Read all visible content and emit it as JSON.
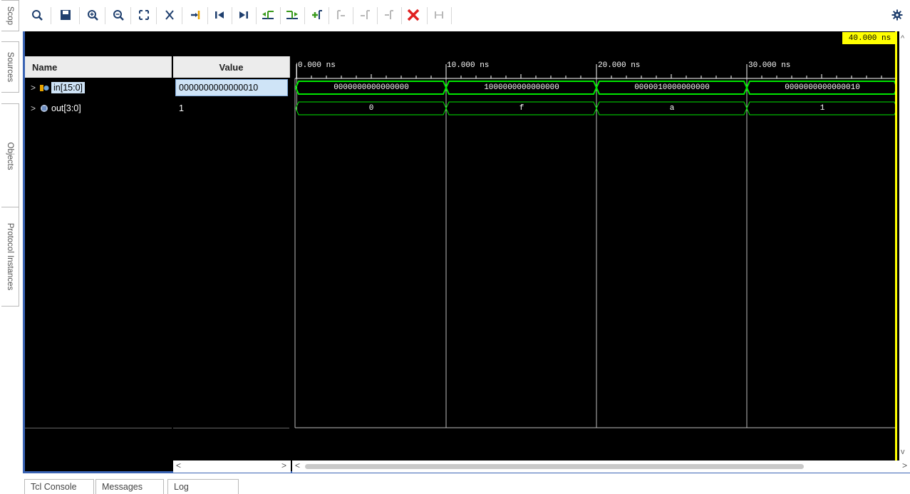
{
  "side_tabs": [
    "Scop",
    "Sources",
    "Objects",
    "Protocol Instances"
  ],
  "toolbar": {
    "icons": [
      "search-icon",
      "save-icon",
      "zoom-in-icon",
      "zoom-out-icon",
      "zoom-fit-icon",
      "cut-icon",
      "goto-cursor-icon",
      "goto-start-icon",
      "goto-end-icon",
      "prev-transition-icon",
      "next-transition-icon",
      "add-marker-icon",
      "prev-marker-icon",
      "next-marker-icon",
      "swap-cursors-icon",
      "delete-icon",
      "snap-icon",
      "settings-icon"
    ]
  },
  "columns": {
    "name": "Name",
    "value": "Value"
  },
  "signals": [
    {
      "name": "in[15:0]",
      "value": "0000000000000010",
      "icon": "input-bus-icon",
      "selected": true
    },
    {
      "name": "out[3:0]",
      "value": "1",
      "icon": "output-bus-icon",
      "selected": false
    }
  ],
  "timeline": {
    "cursor_time": "40.000 ns",
    "tick_labels": [
      "0.000 ns",
      "10.000 ns",
      "20.000 ns",
      "30.000 ns"
    ],
    "segments_in": [
      "0000000000000000",
      "1000000000000000",
      "0000010000000000",
      "0000000000000010"
    ],
    "segments_out": [
      "0",
      "f",
      "a",
      "1"
    ]
  },
  "colors": {
    "wave": "#00e600",
    "cursor": "#ffff00",
    "selection": "#cfe4f7",
    "frame": "#3a64b4"
  },
  "bottom_tabs": [
    "Tcl Console",
    "Messages",
    "Log"
  ]
}
